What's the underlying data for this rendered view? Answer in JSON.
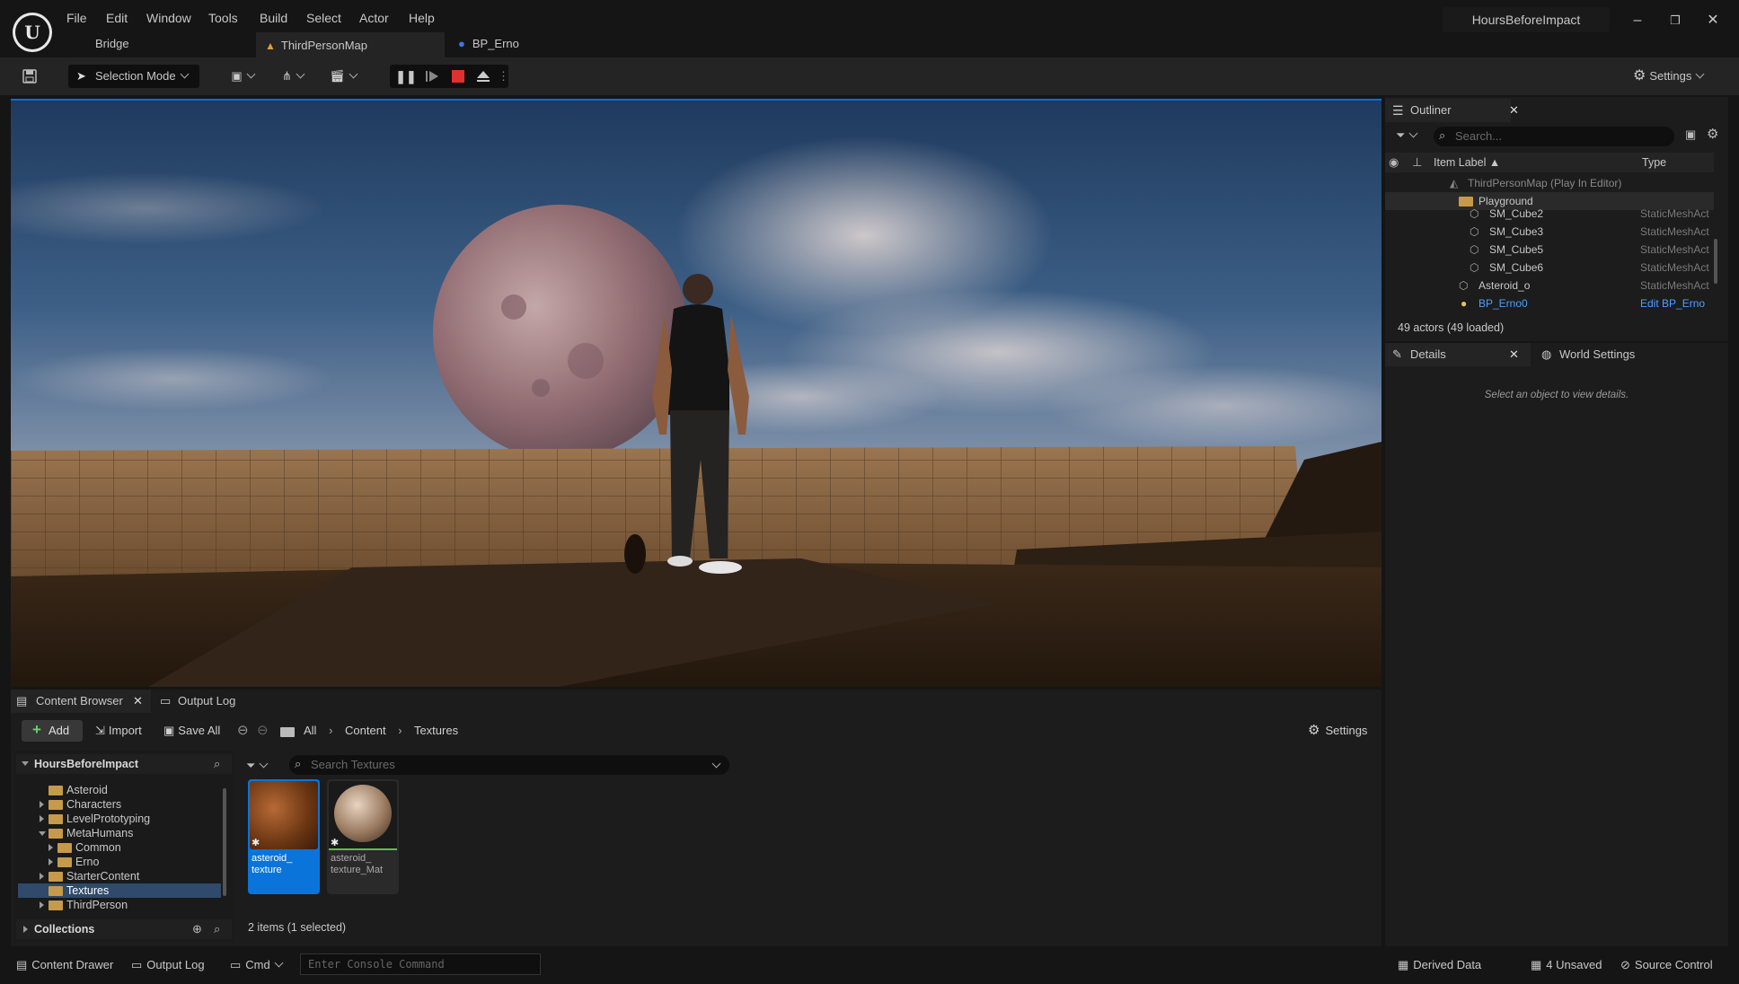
{
  "menu": [
    "File",
    "Edit",
    "Window",
    "Tools",
    "Build",
    "Select",
    "Actor",
    "Help"
  ],
  "tabs": {
    "bridge": "Bridge",
    "map": "ThirdPersonMap",
    "blueprint": "BP_Erno"
  },
  "project_title": "HoursBeforeImpact",
  "window_controls": {
    "minimize": "–",
    "restore": "❐",
    "close": "✕"
  },
  "toolbar": {
    "selection_mode": "Selection Mode",
    "settings": "Settings"
  },
  "outliner": {
    "tab_label": "Outliner",
    "search_placeholder": "Search...",
    "col_label": "Item Label ▲",
    "col_type": "Type",
    "rows": [
      {
        "label": "ThirdPersonMap (Play In Editor)",
        "type": ""
      },
      {
        "label": "Playground",
        "type": ""
      },
      {
        "label": "SM_Cube2",
        "type": "StaticMeshAct"
      },
      {
        "label": "SM_Cube3",
        "type": "StaticMeshAct"
      },
      {
        "label": "SM_Cube5",
        "type": "StaticMeshAct"
      },
      {
        "label": "SM_Cube6",
        "type": "StaticMeshAct"
      },
      {
        "label": "Asteroid_o",
        "type": "StaticMeshAct"
      },
      {
        "label": "BP_Erno0",
        "type": "Edit BP_Erno"
      }
    ],
    "footer": "49 actors (49 loaded)"
  },
  "details": {
    "tab_label": "Details",
    "world_settings": "World Settings",
    "empty_message": "Select an object to view details."
  },
  "content_browser": {
    "tab_label": "Content Browser",
    "output_log_tab": "Output Log",
    "add": "Add",
    "import": "Import",
    "save_all": "Save All",
    "breadcrumb": [
      "All",
      "Content",
      "Textures"
    ],
    "settings": "Settings",
    "root": "HoursBeforeImpact",
    "tree": [
      {
        "label": "Asteroid",
        "indent": 0,
        "arrow": "none"
      },
      {
        "label": "Characters",
        "indent": 0,
        "arrow": "right"
      },
      {
        "label": "LevelPrototyping",
        "indent": 0,
        "arrow": "right"
      },
      {
        "label": "MetaHumans",
        "indent": 0,
        "arrow": "down"
      },
      {
        "label": "Common",
        "indent": 1,
        "arrow": "right"
      },
      {
        "label": "Erno",
        "indent": 1,
        "arrow": "right"
      },
      {
        "label": "StarterContent",
        "indent": 0,
        "arrow": "right"
      },
      {
        "label": "Textures",
        "indent": 0,
        "arrow": "none",
        "selected": true
      },
      {
        "label": "ThirdPerson",
        "indent": 0,
        "arrow": "right"
      }
    ],
    "collections": "Collections",
    "search_placeholder": "Search Textures",
    "assets": [
      {
        "name_line1": "asteroid_",
        "name_line2": "texture",
        "selected": true
      },
      {
        "name_line1": "asteroid_",
        "name_line2": "texture_Mat",
        "selected": false
      }
    ],
    "items_count": "2 items (1 selected)"
  },
  "status_bar": {
    "content_drawer": "Content Drawer",
    "output_log": "Output Log",
    "cmd": "Cmd",
    "console_placeholder": "Enter Console Command",
    "derived_data": "Derived Data",
    "unsaved": "4 Unsaved",
    "source_control": "Source Control"
  },
  "colors": {
    "accent": "#0070e0",
    "folder": "#c69a4b",
    "panel": "#1c1c1c",
    "stop": "#e03030"
  }
}
